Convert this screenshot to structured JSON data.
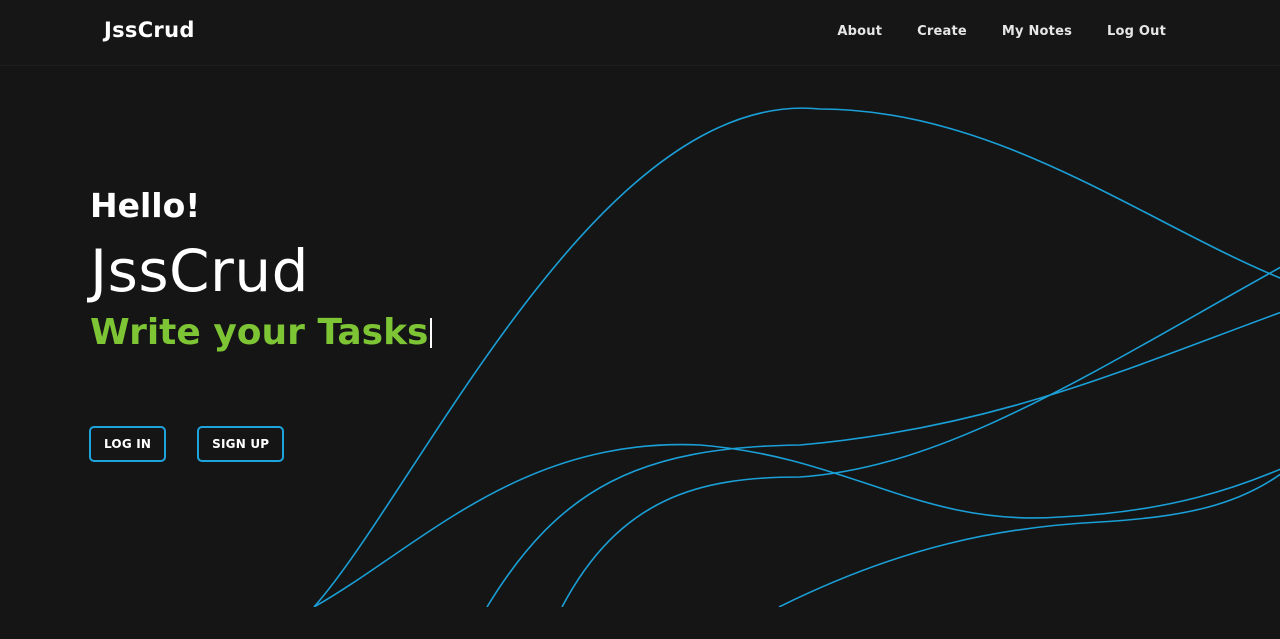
{
  "navbar": {
    "brand": "JssCrud",
    "links": [
      "About",
      "Create",
      "My Notes",
      "Log Out"
    ]
  },
  "hero": {
    "greeting": "Hello!",
    "title": "JssCrud",
    "tagline": "Write your Tasks",
    "buttons": {
      "login": "LOG IN",
      "signup": "SIGN UP"
    }
  },
  "colors": {
    "background": "#151516",
    "accent_green": "#7dc534",
    "accent_blue": "#1ea4dc",
    "wave_line": "#1a9fd6"
  }
}
